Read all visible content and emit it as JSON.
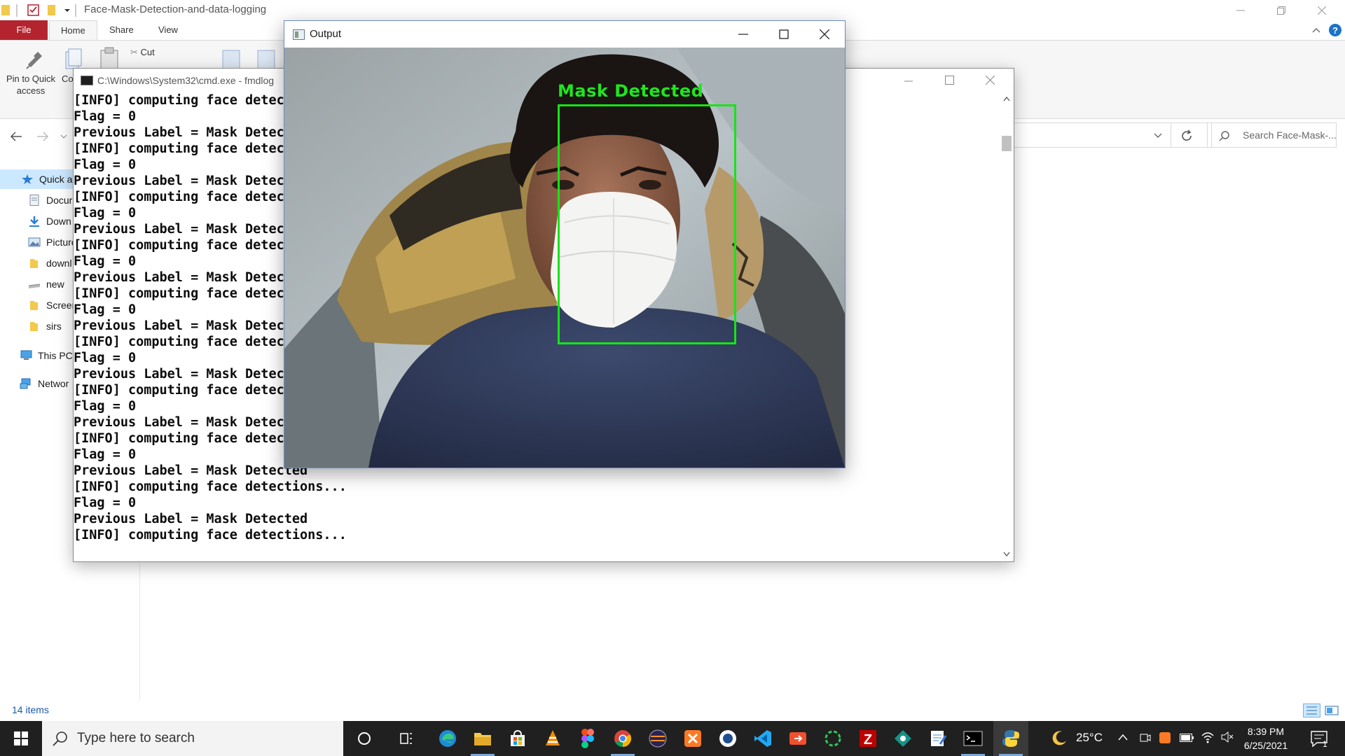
{
  "explorer": {
    "title": "Face-Mask-Detection-and-data-logging",
    "tabs": [
      "File",
      "Home",
      "Share",
      "View"
    ],
    "ribbon": {
      "pin_label": "Pin to Quick access",
      "copy_label": "Co",
      "cut_label": "Cut"
    },
    "search_placeholder": "Search Face-Mask-...",
    "nav": [
      {
        "label": "Quick a",
        "icon": "star-icon"
      },
      {
        "label": "Docur",
        "icon": "document-icon"
      },
      {
        "label": "Down",
        "icon": "download-icon"
      },
      {
        "label": "Picture",
        "icon": "pictures-icon"
      },
      {
        "label": "downl",
        "icon": "folder-icon"
      },
      {
        "label": "new",
        "icon": "drive-icon"
      },
      {
        "label": "Screer",
        "icon": "folder-icon"
      },
      {
        "label": "sirs",
        "icon": "folder-icon"
      },
      {
        "label": "This PC",
        "icon": "pc-icon"
      },
      {
        "label": "Networ",
        "icon": "network-icon"
      }
    ],
    "status": "14 items"
  },
  "cmd": {
    "title": "C:\\Windows\\System32\\cmd.exe - fmdlog",
    "lines": [
      "[INFO] computing face detections...",
      "Flag = 0",
      "Previous Label = Mask Detected",
      "[INFO] computing face detections...",
      "Flag = 0",
      "Previous Label = Mask Detected",
      "[INFO] computing face detections...",
      "Flag = 0",
      "Previous Label = Mask Detected",
      "[INFO] computing face detections...",
      "Flag = 0",
      "Previous Label = Mask Detected",
      "[INFO] computing face detections...",
      "Flag = 0",
      "Previous Label = Mask Detected",
      "[INFO] computing face detections...",
      "Flag = 0",
      "Previous Label = Mask Detected",
      "[INFO] computing face detections...",
      "Flag = 0",
      "Previous Label = Mask Detected",
      "[INFO] computing face detections...",
      "Flag = 0",
      "Previous Label = Mask Detected",
      "[INFO] computing face detections...",
      "Flag = 0",
      "Previous Label = Mask Detected",
      "[INFO] computing face detections..."
    ]
  },
  "output": {
    "title": "Output",
    "detection_label": "Mask Detected",
    "detection_color": "#14e614"
  },
  "taskbar": {
    "search_placeholder": "Type here to search",
    "apps": [
      "cortana-icon",
      "task-view-icon",
      "edge-icon",
      "file-explorer-icon",
      "store-icon",
      "vlc-icon",
      "figma-icon",
      "chrome-icon",
      "eclipse-icon",
      "xampp-icon",
      "app-icon",
      "vscode-icon",
      "git-icon",
      "spinner-icon",
      "filezilla-icon",
      "gitkraken-icon",
      "notepad-icon",
      "terminal-icon",
      "python-icon"
    ],
    "weather": "25°C",
    "time": "8:39 PM",
    "date": "6/25/2021",
    "notification_count": "1"
  }
}
